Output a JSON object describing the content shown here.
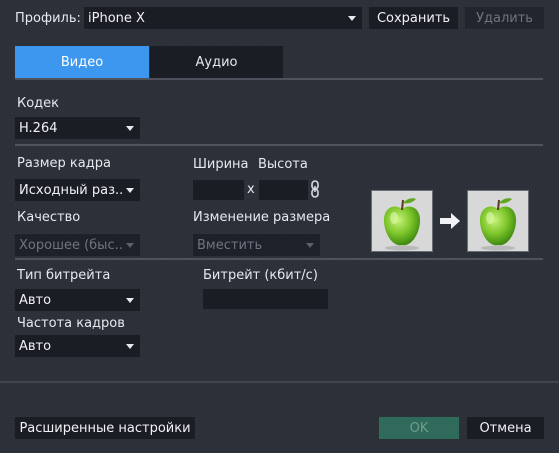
{
  "profile": {
    "label": "Профиль:",
    "value": "iPhone X",
    "save_label": "Сохранить",
    "delete_label": "Удалить"
  },
  "tabs": [
    {
      "label": "Видео",
      "active": true
    },
    {
      "label": "Аудио",
      "active": false
    }
  ],
  "video": {
    "codec_label": "Кодек",
    "codec_value": "H.264",
    "frame_size_label": "Размер кадра",
    "frame_size_value": "Исходный раз...",
    "width_label": "Ширина",
    "height_label": "Высота",
    "width_value": "",
    "height_value": "",
    "x_sep": "x",
    "quality_label": "Качество",
    "quality_value": "Хорошее (быс...",
    "resize_label": "Изменение размера",
    "resize_value": "Вместить",
    "bitrate_type_label": "Тип битрейта",
    "bitrate_type_value": "Авто",
    "bitrate_label": "Битрейт (кбит/с)",
    "bitrate_value": "",
    "framerate_label": "Частота кадров",
    "framerate_value": "Авто"
  },
  "footer": {
    "advanced_label": "Расширенные настройки",
    "ok_label": "OK",
    "cancel_label": "Отмена"
  },
  "colors": {
    "background": "#2b2f38",
    "field": "#1a1d24",
    "tab_active": "#3e97ee",
    "ok_button": "#2f6a5b"
  },
  "icons": {
    "link": "chain-link-icon",
    "arrow": "arrow-right-icon",
    "preview": "green-apple-icon"
  }
}
